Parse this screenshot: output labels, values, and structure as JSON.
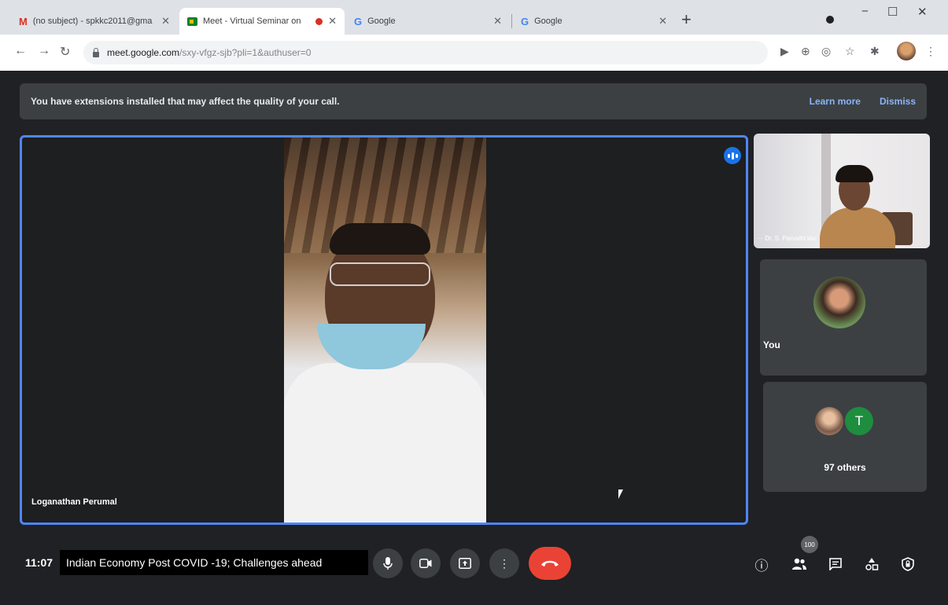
{
  "browser": {
    "tabs": [
      {
        "title": "(no subject) - spkkc2011@gma",
        "icon": "gmail-icon"
      },
      {
        "title": "Meet - Virtual Seminar on",
        "icon": "meet-icon",
        "recording": true
      },
      {
        "title": "Google",
        "icon": "google-icon"
      },
      {
        "title": "Google",
        "icon": "google-icon"
      }
    ],
    "address": {
      "host": "meet.google.com",
      "path": "/sxy-vfgz-sjb?pli=1&authuser=0"
    }
  },
  "banner": {
    "message": "You have extensions installed that may affect the quality of your call.",
    "learn_more": "Learn more",
    "dismiss": "Dismiss"
  },
  "main_tile": {
    "name": "Loganathan Perumal"
  },
  "side_tiles": {
    "presenter_name": "Dr. S. Parvathi kkc",
    "you_label": "You",
    "others_initial": "T",
    "others_count": "97 others"
  },
  "bottom_bar": {
    "time": "11:07",
    "meeting_title": "Indian Economy Post COVID -19; Challenges ahead",
    "participants_badge": "100"
  },
  "colors": {
    "accent": "#4f86f7",
    "end_call": "#ea4335",
    "meet_background": "#202124"
  }
}
